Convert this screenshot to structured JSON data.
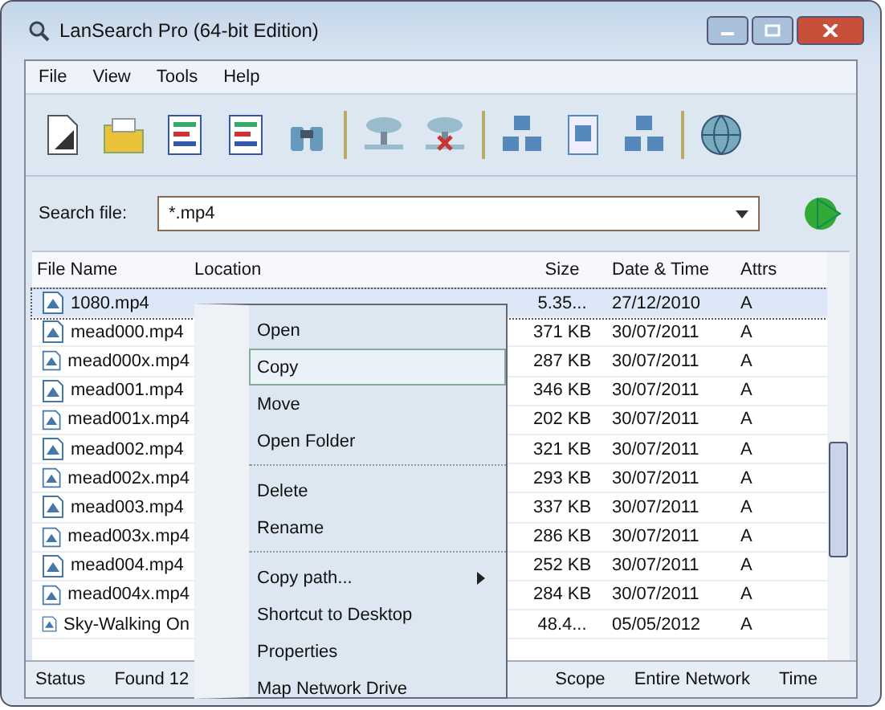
{
  "window": {
    "title": "LanSearch Pro (64-bit Edition)"
  },
  "menu": [
    "File",
    "View",
    "Tools",
    "Help"
  ],
  "toolbar": [
    {
      "kind": "new"
    },
    {
      "kind": "folder"
    },
    {
      "kind": "form"
    },
    {
      "kind": "form"
    },
    {
      "kind": "binoculars",
      "separator_after": true
    },
    {
      "kind": "network"
    },
    {
      "kind": "network-x",
      "separator_after": true
    },
    {
      "kind": "group"
    },
    {
      "kind": "doc"
    },
    {
      "kind": "group",
      "separator_after": true
    },
    {
      "kind": "globe"
    }
  ],
  "search": {
    "label": "Search file:",
    "value": "*.mp4"
  },
  "table": {
    "columns": [
      "File Name",
      "Location",
      "Size",
      "Date & Time",
      "Attrs"
    ],
    "rows": [
      {
        "name": "1080.mp4",
        "size": "5.35...",
        "date": "27/12/2010",
        "attrs": "A",
        "selected": true
      },
      {
        "name": "mead000.mp4",
        "size": "371 KB",
        "date": "30/07/2011",
        "attrs": "A",
        "selected": false
      },
      {
        "name": "mead000x.mp4",
        "size": "287 KB",
        "date": "30/07/2011",
        "attrs": "A",
        "selected": false
      },
      {
        "name": "mead001.mp4",
        "size": "346 KB",
        "date": "30/07/2011",
        "attrs": "A",
        "selected": false
      },
      {
        "name": "mead001x.mp4",
        "size": "202 KB",
        "date": "30/07/2011",
        "attrs": "A",
        "selected": false
      },
      {
        "name": "mead002.mp4",
        "size": "321 KB",
        "date": "30/07/2011",
        "attrs": "A",
        "selected": false
      },
      {
        "name": "mead002x.mp4",
        "size": "293 KB",
        "date": "30/07/2011",
        "attrs": "A",
        "selected": false
      },
      {
        "name": "mead003.mp4",
        "size": "337 KB",
        "date": "30/07/2011",
        "attrs": "A",
        "selected": false
      },
      {
        "name": "mead003x.mp4",
        "size": "286 KB",
        "date": "30/07/2011",
        "attrs": "A",
        "selected": false
      },
      {
        "name": "mead004.mp4",
        "size": "252 KB",
        "date": "30/07/2011",
        "attrs": "A",
        "selected": false
      },
      {
        "name": "mead004x.mp4",
        "size": "284 KB",
        "date": "30/07/2011",
        "attrs": "A",
        "selected": false
      },
      {
        "name": "Sky-Walking On",
        "size": "48.4...",
        "date": "05/05/2012",
        "attrs": "A",
        "selected": false
      }
    ]
  },
  "context_menu": [
    {
      "label": "Open",
      "selected": false
    },
    {
      "label": "Copy",
      "selected": true
    },
    {
      "label": "Move",
      "selected": false
    },
    {
      "label": "Open Folder",
      "selected": false,
      "separator_after": true
    },
    {
      "label": "Delete",
      "selected": false
    },
    {
      "label": "Rename",
      "selected": false,
      "separator_after": true
    },
    {
      "label": "Copy path...",
      "selected": false,
      "submenu": true
    },
    {
      "label": "Shortcut to Desktop",
      "selected": false
    },
    {
      "label": "Properties",
      "selected": false
    },
    {
      "label": "Map Network Drive",
      "selected": false
    }
  ],
  "status_bar": [
    "Status",
    "Found 12",
    "Scope",
    "Entire Network",
    "Time"
  ]
}
